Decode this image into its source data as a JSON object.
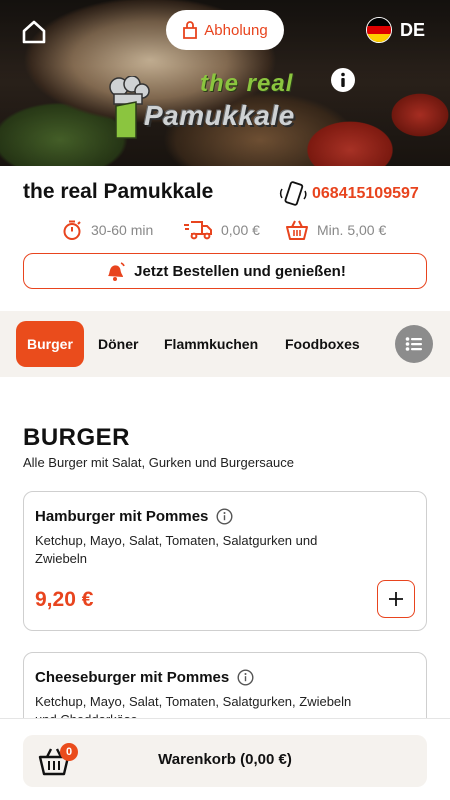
{
  "header": {
    "home_icon": "home-icon",
    "pickup_label": "Abholung",
    "pickup_icon": "bag-icon",
    "language_code": "DE",
    "flag_colors": [
      "#000000",
      "#dd0000",
      "#ffce00"
    ],
    "info_icon": "info-icon"
  },
  "logo": {
    "line1": "the real",
    "line2": "Pamukkale"
  },
  "restaurant": {
    "name": "the real Pamukkale",
    "phone": "068415109597",
    "prep_time": "30-60 min",
    "delivery_fee": "0,00 €",
    "min_order": "Min. 5,00 €",
    "order_cta": "Jetzt Bestellen und genießen!"
  },
  "categories": [
    {
      "label": "Burger",
      "active": true
    },
    {
      "label": "Döner",
      "active": false
    },
    {
      "label": "Flammkuchen",
      "active": false
    },
    {
      "label": "Foodboxes",
      "active": false
    }
  ],
  "section": {
    "title": "BURGER",
    "description": "Alle Burger mit Salat, Gurken und Burgersauce"
  },
  "products": [
    {
      "name": "Hamburger mit Pommes",
      "description": "Ketchup, Mayo, Salat, Tomaten, Salatgurken und Zwiebeln",
      "price": "9,20 €"
    },
    {
      "name": "Cheeseburger mit Pommes",
      "description": "Ketchup, Mayo, Salat, Tomaten, Salatgurken, Zwiebeln und Cheddarkäse",
      "price": ""
    }
  ],
  "cart": {
    "count": "0",
    "label": "Warenkorb (0,00 €)"
  },
  "colors": {
    "accent": "#ea4c1c",
    "accent_text": "#e8441e",
    "soft_bg": "#f5f2ee",
    "muted": "#888888"
  }
}
